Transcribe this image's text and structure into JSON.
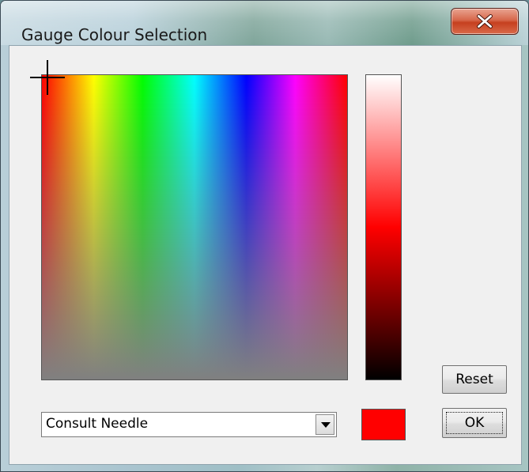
{
  "window": {
    "title": "Gauge Colour Selection"
  },
  "picker": {
    "selected_color": "#ff0000",
    "swatch_color": "#ff0000"
  },
  "buttons": {
    "reset_label": "Reset",
    "ok_label": "OK"
  },
  "dropdown": {
    "value": "Consult Needle"
  },
  "icons": {
    "close": "close-icon",
    "crosshair": "crosshair-icon",
    "dropdown_arrow": "chevron-down-icon"
  }
}
